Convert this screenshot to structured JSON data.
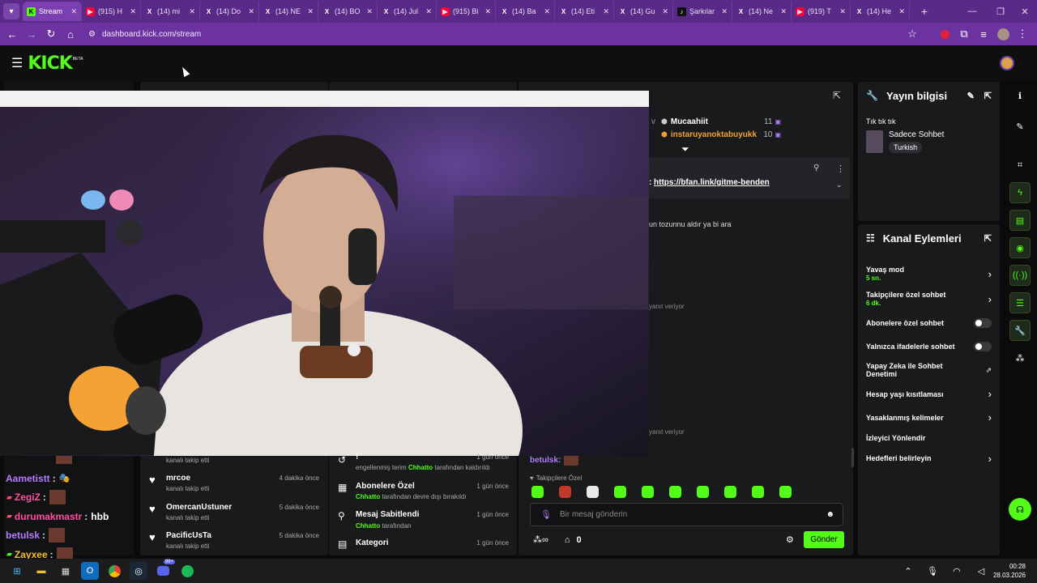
{
  "browser": {
    "tabs": [
      {
        "label": "Stream",
        "fav": "kk",
        "active": true
      },
      {
        "label": "(915) H",
        "fav": "yt"
      },
      {
        "label": "(14) mi",
        "fav": "x"
      },
      {
        "label": "(14) Do",
        "fav": "x"
      },
      {
        "label": "(14) NE",
        "fav": "x"
      },
      {
        "label": "(14) BO",
        "fav": "x"
      },
      {
        "label": "(14) Jul",
        "fav": "x"
      },
      {
        "label": "(915) Bi",
        "fav": "yt"
      },
      {
        "label": "(14) Ba",
        "fav": "x"
      },
      {
        "label": "(14) Eti",
        "fav": "x"
      },
      {
        "label": "(14) Gu",
        "fav": "x"
      },
      {
        "label": "Şarkılar",
        "fav": "tt"
      },
      {
        "label": "(14) Ne",
        "fav": "x"
      },
      {
        "label": "(919) T",
        "fav": "yt"
      },
      {
        "label": "(14) He",
        "fav": "x"
      }
    ],
    "url": "dashboard.kick.com/stream"
  },
  "kick": {
    "logo": "KICK",
    "beta": "BETA"
  },
  "chat_popout": {
    "top_users": [
      {
        "prefix": "v",
        "name": "Mucaahiit",
        "count": "11"
      },
      {
        "name": "instaruyanoktabuyukk",
        "count": "10"
      }
    ],
    "pinned_link": "https://bfan.link/gitme-benden",
    "pinned_prefix": ":",
    "msg1": "un tozunnu aldır ya bi ara",
    "reply1": "yanıt veriyor",
    "reply2": "yanıt veriyor",
    "last_user": "betulsk:",
    "followers_only": "Takipçilere Özel",
    "input_placeholder": "Bir mesaj gönderin",
    "points": "0",
    "send_label": "Gönder"
  },
  "left_chat": [
    {
      "name": "Aametistt",
      "suffix": "🎭",
      "color": "#b57bff"
    },
    {
      "name": "ZegiZ",
      "color": "#ff4fa0"
    },
    {
      "name": "durumakmastr",
      "text": "hbb",
      "color": "#ff4fa0"
    },
    {
      "name": "betulsk",
      "color": "#b57bff"
    },
    {
      "name": "Zayxee",
      "color": "#f3c033"
    }
  ],
  "followers": {
    "partial": "kanalı takip etti",
    "items": [
      {
        "name": "mrcoe",
        "time": "4 dakika önce",
        "sub": "kanalı takip etti"
      },
      {
        "name": "OmercanUstuner",
        "time": "5 dakika önce",
        "sub": "kanalı takip etti"
      },
      {
        "name": "PacificUsTa",
        "time": "5 dakika önce",
        "sub": "kanalı takip etti"
      }
    ]
  },
  "mod_actions": {
    "first_title": "!",
    "first_time": "1 gün önce",
    "first_pre": "engellenmiş terim",
    "first_user": "Chhatto",
    "first_post": "tarafından kaldırıldı",
    "items": [
      {
        "title": "Abonelere Özel",
        "time": "1 gün önce",
        "user": "Chhatto",
        "post": "tarafından devre dışı bırakıldı"
      },
      {
        "title": "Mesaj Sabitlendi",
        "time": "1 gün önce",
        "user": "Chhatto",
        "post": "tarafından"
      },
      {
        "title": "Kategori",
        "time": "1 gün önce"
      }
    ]
  },
  "stream_info": {
    "title": "Yayın bilgisi",
    "stream_title": "Tık tık tık",
    "category": "Sadece Sohbet",
    "language": "Turkish"
  },
  "channel_actions": {
    "title": "Kanal Eylemleri",
    "items": [
      {
        "label": "Yavaş mod",
        "sub": "5 sn.",
        "kind": "chevron"
      },
      {
        "label": "Takipçilere özel sohbet",
        "sub": "6 dk.",
        "kind": "chevron"
      },
      {
        "label": "Abonelere özel sohbet",
        "kind": "toggle"
      },
      {
        "label": "Yalnızca ifadelerle sohbet",
        "kind": "toggle"
      },
      {
        "label": "Yapay Zeka ile Sohbet Denetimi",
        "kind": "external"
      },
      {
        "label": "Hesap yaşı kısıtlaması",
        "kind": "chevron"
      },
      {
        "label": "Yasaklanmış kelimeler",
        "kind": "chevron"
      },
      {
        "label": "İzleyici Yönlendir",
        "kind": "none"
      },
      {
        "label": "Hedefleri belirleyin",
        "kind": "chevron"
      }
    ]
  },
  "taskbar": {
    "time": "00:28",
    "date": "28.03.2026",
    "discord_badge": "99+"
  },
  "colors": {
    "kick_green": "#53fc18",
    "chrome_purple": "#6c33a0",
    "panel": "#191a1c"
  }
}
